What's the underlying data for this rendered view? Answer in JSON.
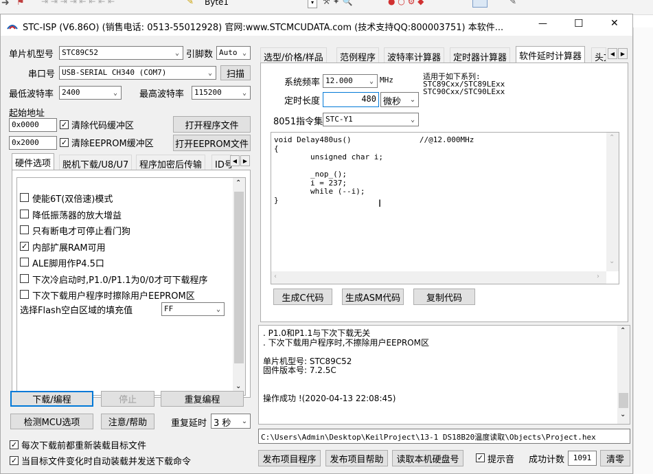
{
  "app_toolbar": {
    "doc_tab": "Byte1"
  },
  "window": {
    "title": "STC-ISP (V6.86O) (销售电话: 0513-55012928) 官网:www.STCMCUDATA.com  (技术支持QQ:800003751) 本软件...",
    "minimize": "—",
    "maximize": "☐",
    "close": "✕"
  },
  "left": {
    "mcu_label": "单片机型号",
    "mcu_value": "STC89C52",
    "pins_label": "引脚数",
    "pins_value": "Auto",
    "port_label": "串口号",
    "port_value": "USB-SERIAL CH340 (COM7)",
    "scan_button": "扫描",
    "min_baud_label": "最低波特率",
    "min_baud_value": "2400",
    "max_baud_label": "最高波特率",
    "max_baud_value": "115200",
    "start_addr_label": "起始地址",
    "addr1": "0x0000",
    "clear_code_label": "清除代码缓冲区",
    "open_program_button": "打开程序文件",
    "addr2": "0x2000",
    "clear_eeprom_label": "清除EEPROM缓冲区",
    "open_eeprom_button": "打开EEPROM文件",
    "tabs": [
      "硬件选项",
      "脱机下载/U8/U7",
      "程序加密后传输",
      "ID号"
    ],
    "options": [
      {
        "label": "使能6T(双倍速)模式",
        "checked": ""
      },
      {
        "label": "降低振荡器的放大增益",
        "checked": ""
      },
      {
        "label": "只有断电才可停止看门狗",
        "checked": ""
      },
      {
        "label": "内部扩展RAM可用",
        "checked": "✓"
      },
      {
        "label": "ALE脚用作P4.5口",
        "checked": ""
      },
      {
        "label": "下次冷启动时,P1.0/P1.1为0/0才可下载程序",
        "checked": ""
      },
      {
        "label": "下次下载用户程序时擦除用户EEPROM区",
        "checked": ""
      }
    ],
    "fill_label": "选择Flash空白区域的填充值",
    "fill_value": "FF",
    "download_button": "下载/编程",
    "stop_button": "停止",
    "repeat_button": "重复编程",
    "detect_button": "检测MCU选项",
    "help_button": "注意/帮助",
    "repeat_delay_label": "重复延时",
    "repeat_delay_value": "3 秒",
    "reload_label": "每次下载前都重新装载目标文件",
    "auto_reload_label": "当目标文件变化时自动装载并发送下载命令"
  },
  "right": {
    "tabs": [
      "选型/价格/样品",
      "范例程序",
      "波特率计算器",
      "定时器计算器",
      "软件延时计算器",
      "头文"
    ],
    "freq_label": "系统频率",
    "freq_value": "12.000",
    "freq_unit": "MHz",
    "time_label": "定时长度",
    "time_value": "480",
    "time_unit": "微秒",
    "isa_label": "8051指令集",
    "isa_value": "STC-Y1",
    "series_text": [
      "适用于如下系列:",
      "STC89Cxx/STC89LExx",
      "STC90Cxx/STC90LExx"
    ],
    "code_lines": [
      "void Delay480us()\t\t//@12.000MHz",
      "{",
      "\tunsigned char i;",
      "",
      "\t_nop_();",
      "\ti = 237;",
      "\twhile (--i);",
      "}"
    ],
    "gen_c_button": "生成C代码",
    "gen_asm_button": "生成ASM代码",
    "copy_button": "复制代码",
    "log_lines": [
      ". P1.0和P1.1与下次下载无关",
      ". 下次下载用户程序时,不擦除用户EEPROM区",
      "",
      "单片机型号: STC89C52",
      "固件版本号: 7.2.5C",
      "",
      "",
      "操作成功 !(2020-04-13 22:08:45)"
    ],
    "path_value": "C:\\Users\\Admin\\Desktop\\KeilProject\\13-1 DS18B20温度读取\\Objects\\Project.hex",
    "publish_project_button": "发布项目程序",
    "publish_help_button": "发布项目帮助",
    "read_disk_button": "读取本机硬盘号",
    "beep_label": "提示音",
    "success_count_label": "成功计数",
    "success_count_value": "1091",
    "clear_button": "清零"
  }
}
